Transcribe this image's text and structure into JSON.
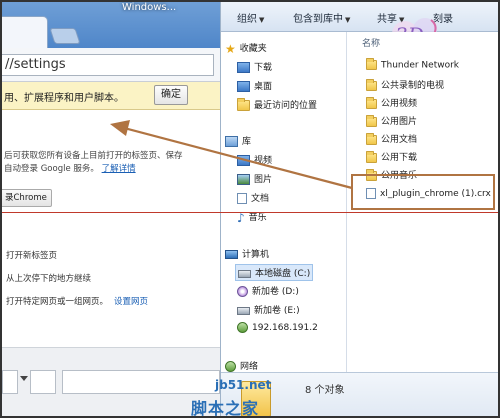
{
  "chrome": {
    "title_fragment": "Windows...",
    "address": "//settings",
    "infobar_text": "用、扩展程序和用户脚本。",
    "confirm_label": "确定",
    "sync_line1": "后可获取您所有设备上目前打开的标签页、保存",
    "sync_line2": "自动登录 Google 服务。",
    "sync_link": "了解详情",
    "signin_label": "录Chrome",
    "startup": [
      {
        "text": "打开新标签页",
        "link": ""
      },
      {
        "text": "从上次停下的地方继续",
        "link": ""
      },
      {
        "text": "打开特定网页或一组网页。",
        "link": "设置网页"
      }
    ]
  },
  "explorer": {
    "toolbar": [
      {
        "label": "组织"
      },
      {
        "label": "包含到库中"
      },
      {
        "label": "共享"
      },
      {
        "label": "刻录"
      }
    ],
    "nav": {
      "favorites": "收藏夹",
      "favorites_items": [
        "下载",
        "桌面",
        "最近访问的位置"
      ],
      "libraries": "库",
      "library_items": [
        "视频",
        "图片",
        "文档",
        "音乐"
      ],
      "computer": "计算机",
      "drives": [
        "本地磁盘 (C:)",
        "新加卷 (D:)",
        "新加卷 (E:)",
        "192.168.191.2"
      ],
      "network": "网络"
    },
    "column_header": "名称",
    "files": [
      "Thunder Network",
      "公共录制的电视",
      "公用视频",
      "公用图片",
      "公用文档",
      "公用下载",
      "公用音乐",
      "xl_plugin_chrome (1).crx"
    ],
    "status": "8 个对象",
    "logo_text": "3D"
  },
  "watermark": {
    "site": "jb51.net",
    "name": "脚本之家"
  },
  "colors": {
    "annotation": "#b07442",
    "divider": "#c0392b",
    "link": "#1a5fb4"
  }
}
